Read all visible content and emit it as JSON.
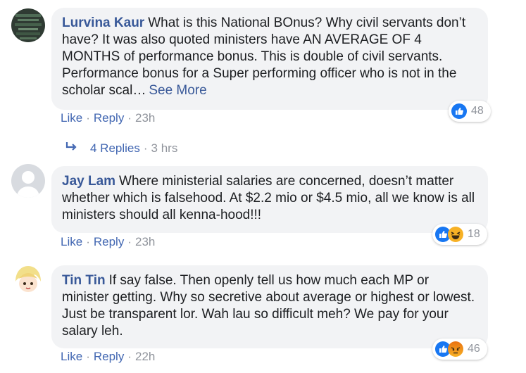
{
  "comments": [
    {
      "author": "Lurvina Kaur",
      "text": "What is this National BOnus? Why civil servants don’t have? It was also quoted ministers have AN AVERAGE OF 4 MONTHS of performance bonus. This is double of civil servants. Performance bonus for a Super performing officer who is not in the scholar scal…",
      "see_more": "See More",
      "like": "Like",
      "reply": "Reply",
      "time": "23h",
      "reaction_count": "48",
      "reaction_icons": [
        "like-icon"
      ]
    },
    {
      "author": "Jay Lam",
      "text": "Where ministerial salaries are concerned, doesn’t matter whether which is falsehood. At $2.2 mio or $4.5 mio, all we know is all ministers should all kenna-hood!!!",
      "like": "Like",
      "reply": "Reply",
      "time": "23h",
      "reaction_count": "18",
      "reaction_icons": [
        "like-icon",
        "haha-icon"
      ]
    },
    {
      "author": "Tin Tin",
      "text": "If say false. Then openly tell us how much each MP or minister getting. Why so secretive about average or highest or lowest. Just be transparent lor. Wah lau so difficult meh? We pay for your salary leh.",
      "like": "Like",
      "reply": "Reply",
      "time": "22h",
      "reaction_count": "46",
      "reaction_icons": [
        "like-icon",
        "angry-icon"
      ]
    }
  ],
  "replies": {
    "label": "4 Replies",
    "time": "3 hrs"
  },
  "colors": {
    "link": "#385898",
    "action": "#4267b2",
    "muted": "#90949c",
    "bubble": "#f2f3f5",
    "like_blue": "#1877f2"
  }
}
